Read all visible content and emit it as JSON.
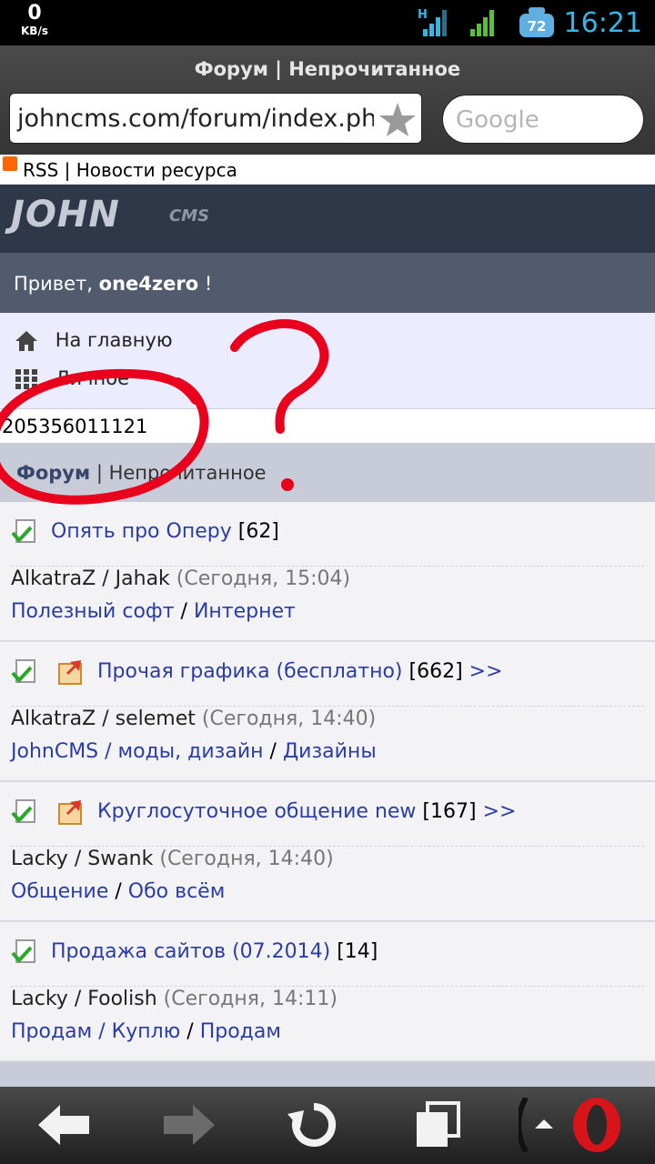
{
  "status": {
    "speed_value": "0",
    "speed_unit": "KB/s",
    "battery": "72",
    "time": "16:21",
    "network_type": "H"
  },
  "browser": {
    "tab_title": "Форум | Непрочитанное",
    "url": "johncms.com/forum/index.php?",
    "search_placeholder": "Google"
  },
  "page": {
    "rss_text": "RSS | Новости ресурса",
    "logo_john": "JOHN",
    "logo_cms": "CMS",
    "greeting_prefix": "Привет,",
    "username": "one4zero",
    "greeting_suffix": "!",
    "menu": [
      {
        "label": "На главную",
        "icon": "home-icon"
      },
      {
        "label": "Личное",
        "icon": "grid-icon"
      }
    ],
    "number_line": "205356011121",
    "breadcrumb_forum": "Форум",
    "breadcrumb_rest": "| Непрочитанное",
    "topics": [
      {
        "title": "Опять про Оперу",
        "count": "[62]",
        "more": "",
        "pinned": false,
        "author": "AlkatraZ",
        "last": "Jahak",
        "time": "(Сегодня, 15:04)",
        "cat1": "Полезный софт",
        "cat2": "Интернет",
        "sep": "/"
      },
      {
        "title": "Прочая графика (бесплатно)",
        "count": "[662]",
        "more": ">>",
        "pinned": true,
        "author": "AlkatraZ",
        "last": "selemet",
        "time": "(Сегодня, 14:40)",
        "cat1": "JohnCMS / моды, дизайн",
        "cat2": "Дизайны",
        "sep": "/"
      },
      {
        "title": "Круглосуточное общение new",
        "count": "[167]",
        "more": ">>",
        "pinned": true,
        "author": "Lacky",
        "last": "Swank",
        "time": "(Сегодня, 14:40)",
        "cat1": "Общение",
        "cat2": "Обо всём",
        "sep": "/"
      },
      {
        "title": "Продажа сайтов (07.2014)",
        "count": "[14]",
        "more": "",
        "pinned": false,
        "author": "Lacky",
        "last": "Foolish",
        "time": "(Сегодня, 14:11)",
        "cat1": "Продам / Куплю",
        "cat2": "Продам",
        "sep": "/"
      }
    ]
  },
  "annotation": {
    "mark": "?",
    "color": "#e8001c"
  },
  "colors": {
    "header_bg": "#2f3849",
    "hello_bg": "#525a6e",
    "link": "#2b3da5",
    "clock": "#33b5e5"
  }
}
